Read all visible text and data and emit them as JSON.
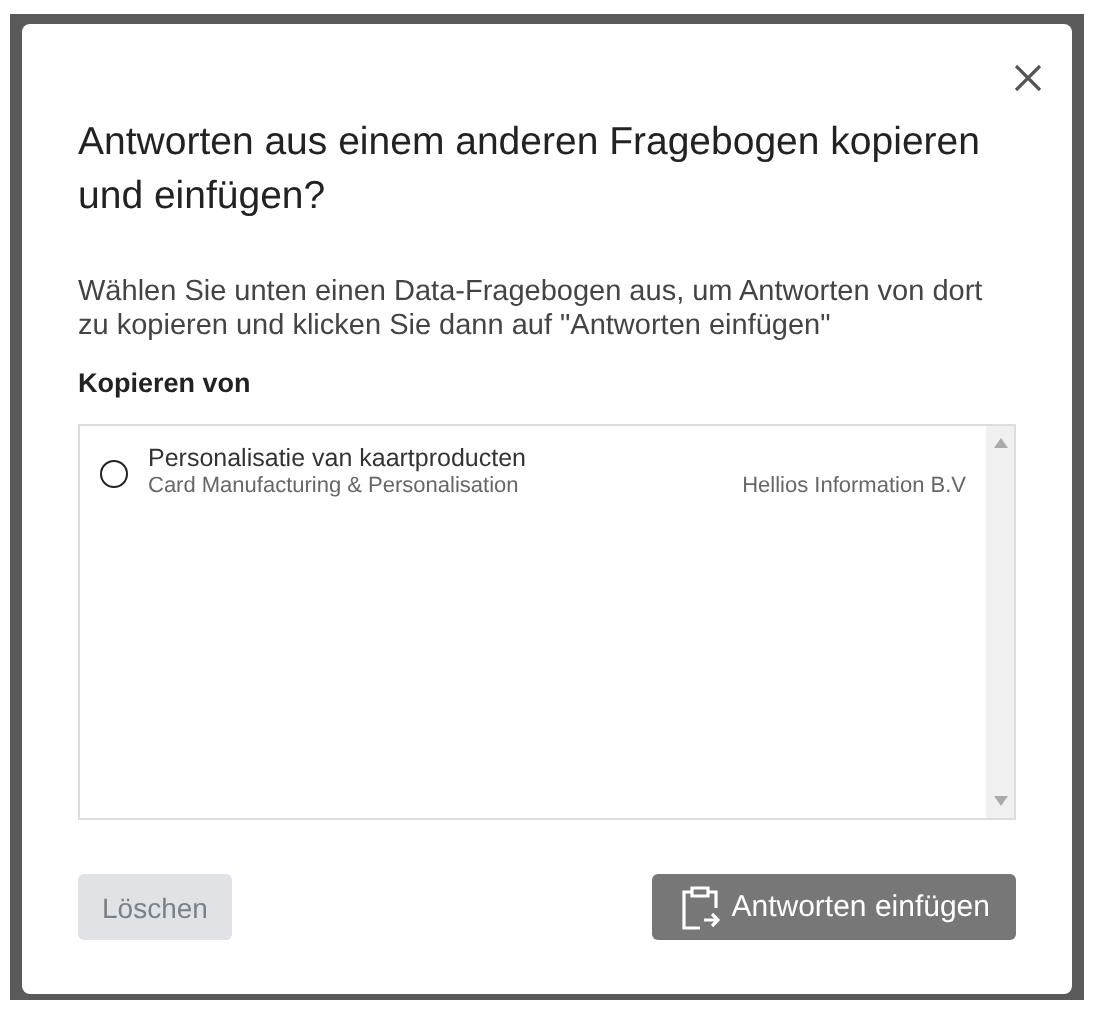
{
  "dialog": {
    "title": "Antworten aus einem anderen Fragebogen kopieren und einfügen?",
    "description": "Wählen Sie unten einen Data-Fragebogen aus, um Antworten von dort zu kopieren und klicken Sie dann auf \"Antworten einfügen\"",
    "section_label": "Kopieren von",
    "options": [
      {
        "name": "Personalisatie van kaartproducten",
        "category": "Card Manufacturing & Personalisation",
        "company": "Hellios Information B.V",
        "selected": false
      }
    ],
    "buttons": [
      {
        "kind": "clear",
        "label": "Löschen",
        "disabled": true
      },
      {
        "kind": "paste",
        "label": "Antworten einfügen",
        "disabled": true
      }
    ]
  }
}
